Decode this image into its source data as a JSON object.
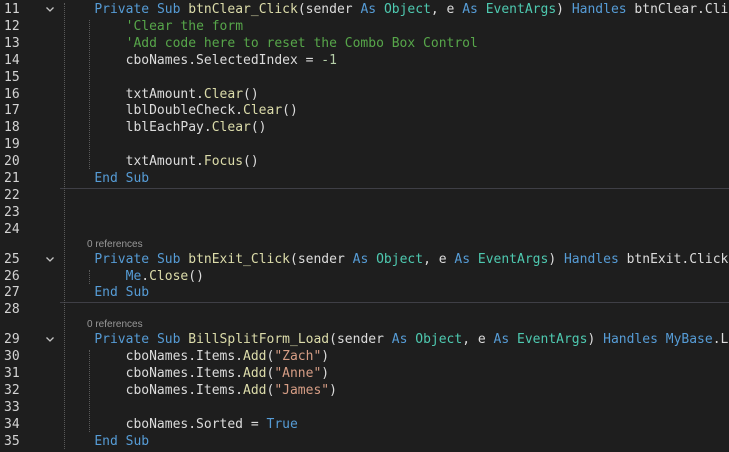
{
  "editor": {
    "lines": [
      {
        "num": "11",
        "fold": true,
        "tokens": [
          [
            "    ",
            "id"
          ],
          [
            "Private",
            "kw"
          ],
          [
            " ",
            "id"
          ],
          [
            "Sub",
            "kw"
          ],
          [
            " ",
            "id"
          ],
          [
            "btnClear_Click",
            "fn"
          ],
          [
            "(sender ",
            "id"
          ],
          [
            "As",
            "kw"
          ],
          [
            " ",
            "id"
          ],
          [
            "Object",
            "ty"
          ],
          [
            ", e ",
            "id"
          ],
          [
            "As",
            "kw"
          ],
          [
            " ",
            "id"
          ],
          [
            "EventArgs",
            "ty"
          ],
          [
            ") ",
            "id"
          ],
          [
            "Handles",
            "kw"
          ],
          [
            " btnClear.Click",
            "id"
          ]
        ]
      },
      {
        "num": "12",
        "fold": false,
        "tokens": [
          [
            "        ",
            "id"
          ],
          [
            "'Clear the form",
            "cm"
          ]
        ]
      },
      {
        "num": "13",
        "fold": false,
        "tokens": [
          [
            "        ",
            "id"
          ],
          [
            "'Add code here to reset the Combo Box Control",
            "cm"
          ]
        ]
      },
      {
        "num": "14",
        "fold": false,
        "tokens": [
          [
            "        cboNames.SelectedIndex = ",
            "id"
          ],
          [
            "-1",
            "nu"
          ]
        ]
      },
      {
        "num": "15",
        "fold": false,
        "tokens": []
      },
      {
        "num": "16",
        "fold": false,
        "tokens": [
          [
            "        txtAmount.",
            "id"
          ],
          [
            "Clear",
            "fn"
          ],
          [
            "()",
            "id"
          ]
        ]
      },
      {
        "num": "17",
        "fold": false,
        "tokens": [
          [
            "        lblDoubleCheck.",
            "id"
          ],
          [
            "Clear",
            "fn"
          ],
          [
            "()",
            "id"
          ]
        ]
      },
      {
        "num": "18",
        "fold": false,
        "tokens": [
          [
            "        lblEachPay.",
            "id"
          ],
          [
            "Clear",
            "fn"
          ],
          [
            "()",
            "id"
          ]
        ]
      },
      {
        "num": "19",
        "fold": false,
        "tokens": []
      },
      {
        "num": "20",
        "fold": false,
        "tokens": [
          [
            "        txtAmount.",
            "id"
          ],
          [
            "Focus",
            "fn"
          ],
          [
            "()",
            "id"
          ]
        ]
      },
      {
        "num": "21",
        "fold": false,
        "tokens": [
          [
            "    ",
            "id"
          ],
          [
            "End",
            "kw"
          ],
          [
            " ",
            "id"
          ],
          [
            "Sub",
            "kw"
          ]
        ]
      },
      {
        "num": "22",
        "fold": false,
        "tokens": []
      },
      {
        "num": "23",
        "fold": false,
        "tokens": []
      },
      {
        "num": "24",
        "fold": false,
        "tokens": []
      },
      {
        "num": "25",
        "fold": true,
        "ref": "0 references",
        "tokens": [
          [
            "    ",
            "id"
          ],
          [
            "Private",
            "kw"
          ],
          [
            " ",
            "id"
          ],
          [
            "Sub",
            "kw"
          ],
          [
            " ",
            "id"
          ],
          [
            "btnExit_Click",
            "fn"
          ],
          [
            "(sender ",
            "id"
          ],
          [
            "As",
            "kw"
          ],
          [
            " ",
            "id"
          ],
          [
            "Object",
            "ty"
          ],
          [
            ", e ",
            "id"
          ],
          [
            "As",
            "kw"
          ],
          [
            " ",
            "id"
          ],
          [
            "EventArgs",
            "ty"
          ],
          [
            ") ",
            "id"
          ],
          [
            "Handles",
            "kw"
          ],
          [
            " btnExit.Click",
            "id"
          ]
        ]
      },
      {
        "num": "26",
        "fold": false,
        "tokens": [
          [
            "        ",
            "id"
          ],
          [
            "Me",
            "kw"
          ],
          [
            ".",
            "id"
          ],
          [
            "Close",
            "fn"
          ],
          [
            "()",
            "id"
          ]
        ]
      },
      {
        "num": "27",
        "fold": false,
        "tokens": [
          [
            "    ",
            "id"
          ],
          [
            "End",
            "kw"
          ],
          [
            " ",
            "id"
          ],
          [
            "Sub",
            "kw"
          ]
        ]
      },
      {
        "num": "28",
        "fold": false,
        "tokens": []
      },
      {
        "num": "29",
        "fold": true,
        "ref": "0 references",
        "tokens": [
          [
            "    ",
            "id"
          ],
          [
            "Private",
            "kw"
          ],
          [
            " ",
            "id"
          ],
          [
            "Sub",
            "kw"
          ],
          [
            " ",
            "id"
          ],
          [
            "BillSplitForm_Load",
            "fn"
          ],
          [
            "(sender ",
            "id"
          ],
          [
            "As",
            "kw"
          ],
          [
            " ",
            "id"
          ],
          [
            "Object",
            "ty"
          ],
          [
            ", e ",
            "id"
          ],
          [
            "As",
            "kw"
          ],
          [
            " ",
            "id"
          ],
          [
            "EventArgs",
            "ty"
          ],
          [
            ") ",
            "id"
          ],
          [
            "Handles",
            "kw"
          ],
          [
            " ",
            "id"
          ],
          [
            "MyBase",
            "kw"
          ],
          [
            ".Load",
            "id"
          ]
        ]
      },
      {
        "num": "30",
        "fold": false,
        "tokens": [
          [
            "        cboNames.Items.",
            "id"
          ],
          [
            "Add",
            "fn"
          ],
          [
            "(",
            "id"
          ],
          [
            "\"Zach\"",
            "st"
          ],
          [
            ")",
            "id"
          ]
        ]
      },
      {
        "num": "31",
        "fold": false,
        "tokens": [
          [
            "        cboNames.Items.",
            "id"
          ],
          [
            "Add",
            "fn"
          ],
          [
            "(",
            "id"
          ],
          [
            "\"Anne\"",
            "st"
          ],
          [
            ")",
            "id"
          ]
        ]
      },
      {
        "num": "32",
        "fold": false,
        "tokens": [
          [
            "        cboNames.Items.",
            "id"
          ],
          [
            "Add",
            "fn"
          ],
          [
            "(",
            "id"
          ],
          [
            "\"James\"",
            "st"
          ],
          [
            ")",
            "id"
          ]
        ]
      },
      {
        "num": "33",
        "fold": false,
        "tokens": []
      },
      {
        "num": "34",
        "fold": false,
        "tokens": [
          [
            "        cboNames.Sorted = ",
            "id"
          ],
          [
            "True",
            "kw"
          ]
        ]
      },
      {
        "num": "35",
        "fold": false,
        "tokens": [
          [
            "    ",
            "id"
          ],
          [
            "End",
            "kw"
          ],
          [
            " ",
            "id"
          ],
          [
            "Sub",
            "kw"
          ]
        ]
      }
    ],
    "fold_icon": "chevron-down-icon",
    "colors": {
      "background": "#1e1e1e",
      "keyword": "#569cd6",
      "type": "#4ec9b0",
      "comment": "#57a64a",
      "string": "#d69d85",
      "method": "#dcdcaa",
      "text": "#dcdcdc"
    }
  }
}
